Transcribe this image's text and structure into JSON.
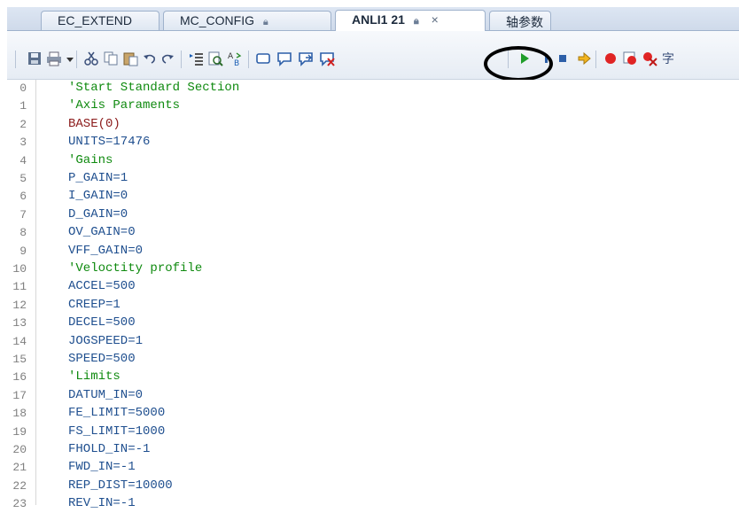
{
  "tabs": [
    {
      "label": "EC_EXTEND",
      "locked": false,
      "active": false
    },
    {
      "label": "MC_CONFIG",
      "locked": true,
      "active": false
    },
    {
      "label": "ANLI1 21",
      "locked": true,
      "active": true,
      "close": "×"
    },
    {
      "label": "轴参数",
      "locked": false,
      "active": false
    }
  ],
  "toolbar": {
    "icons": [
      "save-icon",
      "print-icon",
      "dropdown-icon",
      "cut-icon",
      "copy-icon",
      "paste-icon",
      "undo-icon",
      "redo-icon",
      "indent-icon",
      "find-icon",
      "replace-icon",
      "rect-icon",
      "comment-icon",
      "uncomment-icon",
      "delete-comment-icon",
      "run-icon",
      "pause-icon",
      "stop-icon",
      "step-icon",
      "breakpoint-icon",
      "clear-breakpoint-icon",
      "remove-breakpoints-icon",
      "more-icon"
    ],
    "highlight_circle": true
  },
  "code_lines": [
    {
      "n": "0",
      "text": "'Start Standard Section",
      "style": "comment"
    },
    {
      "n": "1",
      "text": "'Axis Paraments",
      "style": "comment"
    },
    {
      "n": "2",
      "text": "BASE(0)",
      "style": "kw"
    },
    {
      "n": "3",
      "text": "UNITS=17476",
      "style": "code"
    },
    {
      "n": "4",
      "text": "'Gains",
      "style": "comment"
    },
    {
      "n": "5",
      "text": "P_GAIN=1",
      "style": "code"
    },
    {
      "n": "6",
      "text": "I_GAIN=0",
      "style": "code"
    },
    {
      "n": "7",
      "text": "D_GAIN=0",
      "style": "code"
    },
    {
      "n": "8",
      "text": "OV_GAIN=0",
      "style": "code"
    },
    {
      "n": "9",
      "text": "VFF_GAIN=0",
      "style": "code"
    },
    {
      "n": "10",
      "text": "'Veloctity profile",
      "style": "comment"
    },
    {
      "n": "11",
      "text": "ACCEL=500",
      "style": "code"
    },
    {
      "n": "12",
      "text": "CREEP=1",
      "style": "code"
    },
    {
      "n": "13",
      "text": "DECEL=500",
      "style": "code"
    },
    {
      "n": "14",
      "text": "JOGSPEED=1",
      "style": "code"
    },
    {
      "n": "15",
      "text": "SPEED=500",
      "style": "code"
    },
    {
      "n": "16",
      "text": "'Limits",
      "style": "comment"
    },
    {
      "n": "17",
      "text": "DATUM_IN=0",
      "style": "code"
    },
    {
      "n": "18",
      "text": "FE_LIMIT=5000",
      "style": "code"
    },
    {
      "n": "19",
      "text": "FS_LIMIT=1000",
      "style": "code"
    },
    {
      "n": "20",
      "text": "FHOLD_IN=-1",
      "style": "code"
    },
    {
      "n": "21",
      "text": "FWD_IN=-1",
      "style": "code"
    },
    {
      "n": "22",
      "text": "REP_DIST=10000",
      "style": "code"
    },
    {
      "n": "23",
      "text": "REV_IN=-1",
      "style": "code"
    }
  ]
}
